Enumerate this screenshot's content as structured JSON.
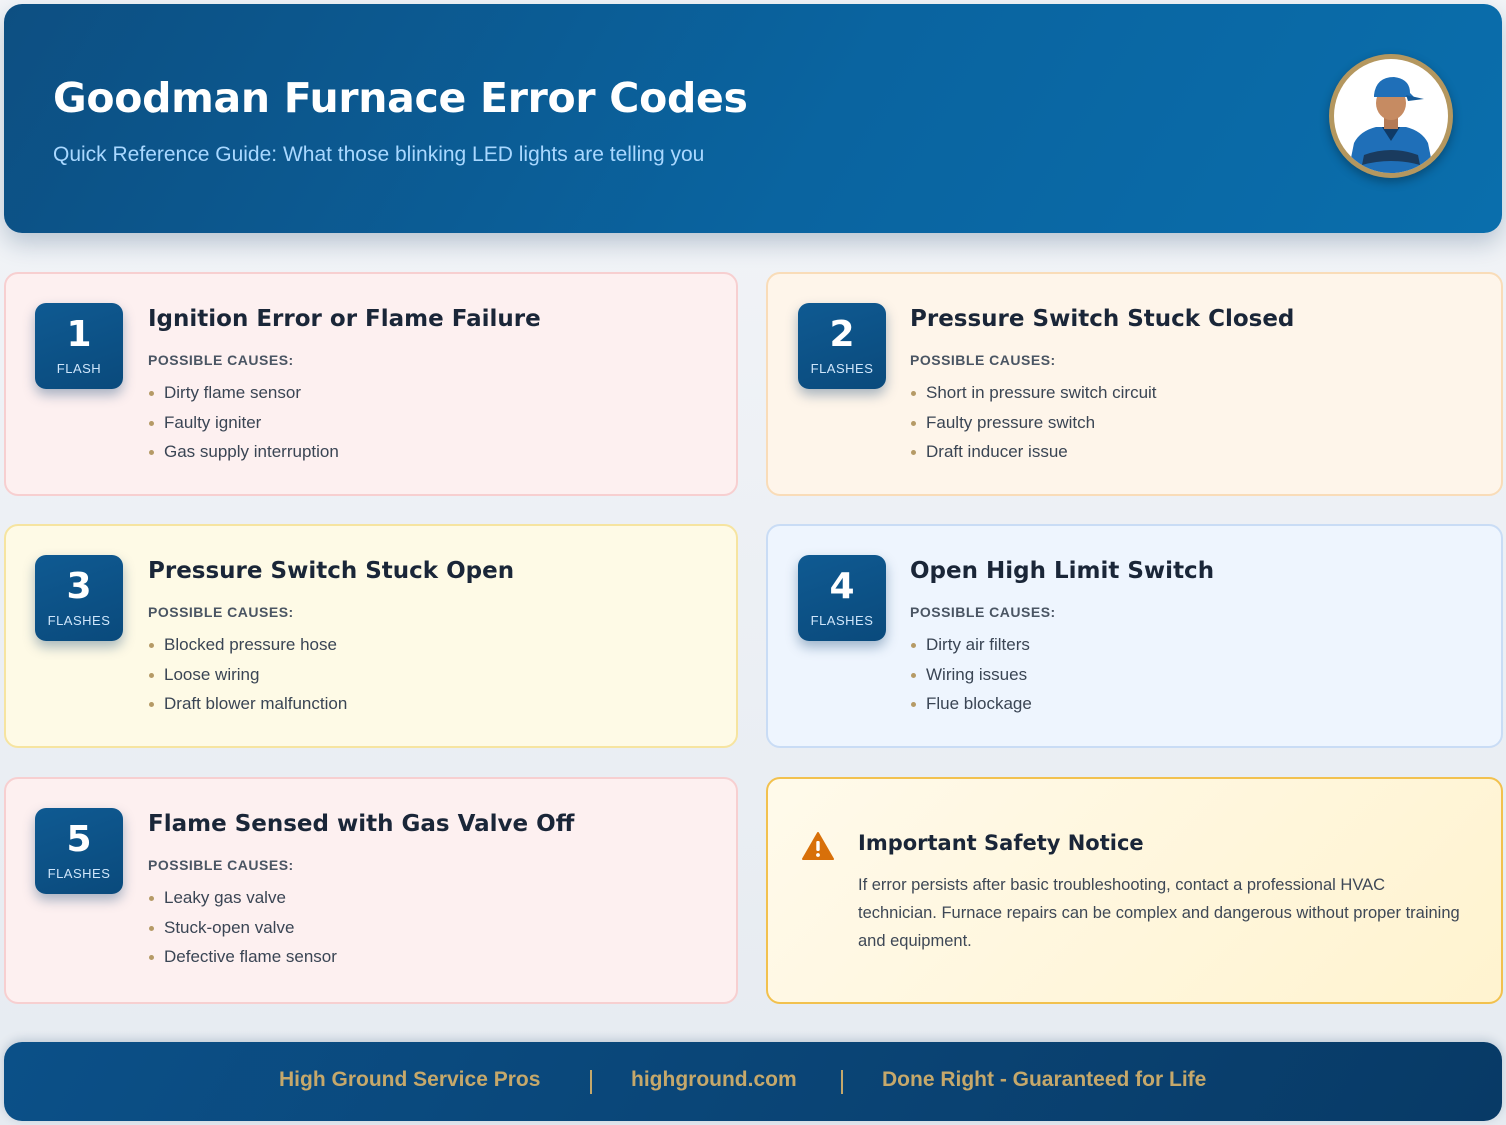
{
  "header": {
    "title": "Goodman Furnace Error Codes",
    "subtitle": "Quick Reference Guide: What those blinking LED lights are telling you"
  },
  "causes_label": "POSSIBLE CAUSES:",
  "codes": [
    {
      "number": "1",
      "unit": "FLASH",
      "title": "Ignition Error or Flame Failure",
      "causes": [
        "Dirty flame sensor",
        "Faulty igniter",
        "Gas supply interruption"
      ]
    },
    {
      "number": "2",
      "unit": "FLASHES",
      "title": "Pressure Switch Stuck Closed",
      "causes": [
        "Short in pressure switch circuit",
        "Faulty pressure switch",
        "Draft inducer issue"
      ]
    },
    {
      "number": "3",
      "unit": "FLASHES",
      "title": "Pressure Switch Stuck Open",
      "causes": [
        "Blocked pressure hose",
        "Loose wiring",
        "Draft blower malfunction"
      ]
    },
    {
      "number": "4",
      "unit": "FLASHES",
      "title": "Open High Limit Switch",
      "causes": [
        "Dirty air filters",
        "Wiring issues",
        "Flue blockage"
      ]
    },
    {
      "number": "5",
      "unit": "FLASHES",
      "title": "Flame Sensed with Gas Valve Off",
      "causes": [
        "Leaky gas valve",
        "Stuck-open valve",
        "Defective flame sensor"
      ]
    }
  ],
  "notice": {
    "icon": "warning-icon",
    "title": "Important Safety Notice",
    "text": "If error persists after basic troubleshooting, contact a professional HVAC technician. Furnace repairs can be complex and dangerous without proper training and equipment."
  },
  "footer": {
    "company": "High Ground Service Pros",
    "website": "highground.com",
    "tagline": "Done Right - Guaranteed for Life"
  },
  "colors": {
    "header_blue": "#0a64a0",
    "footer_gold": "#c5a86b",
    "warning_orange": "#d8700a"
  }
}
